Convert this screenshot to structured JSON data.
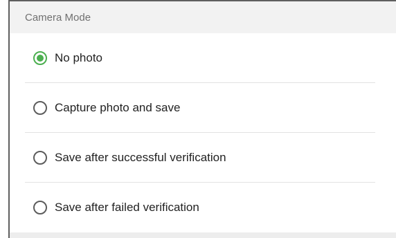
{
  "dialog": {
    "title": "Camera Mode",
    "options": [
      {
        "label": "No photo",
        "selected": true
      },
      {
        "label": "Capture photo and save",
        "selected": false
      },
      {
        "label": "Save after successful verification",
        "selected": false
      },
      {
        "label": "Save after failed verification",
        "selected": false
      }
    ]
  },
  "colors": {
    "accent": "#4caf50",
    "header_bg": "#f2f2f2"
  }
}
